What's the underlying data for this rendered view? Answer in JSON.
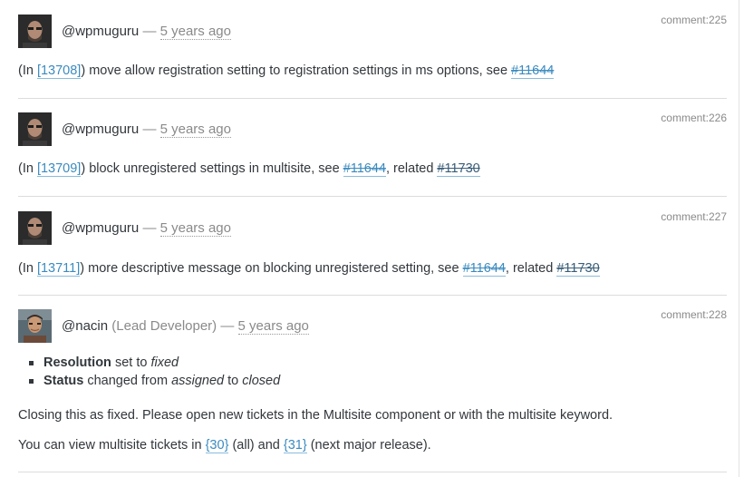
{
  "comments": [
    {
      "author": "@wpmuguru",
      "dash": "—",
      "ago": "5 years ago",
      "id": "comment:225",
      "text": {
        "pre": "(In ",
        "changeset": "[13708]",
        "mid": ") move allow registration setting to registration settings in ms options, see ",
        "ticket1": "#11644"
      }
    },
    {
      "author": "@wpmuguru",
      "dash": "—",
      "ago": "5 years ago",
      "id": "comment:226",
      "text": {
        "pre": "(In ",
        "changeset": "[13709]",
        "mid": ") block unregistered settings in multisite, see ",
        "ticket1": "#11644",
        "sep": ", related ",
        "ticket2": "#11730"
      }
    },
    {
      "author": "@wpmuguru",
      "dash": "—",
      "ago": "5 years ago",
      "id": "comment:227",
      "text": {
        "pre": "(In ",
        "changeset": "[13711]",
        "mid": ") more descriptive message on blocking unregistered setting, see ",
        "ticket1": "#11644",
        "sep": ", related ",
        "ticket2": "#11730"
      }
    },
    {
      "author": "@nacin",
      "role": "(Lead Developer)",
      "dash": "—",
      "ago": "5 years ago",
      "id": "comment:228",
      "changes": [
        {
          "field": "Resolution",
          "verb": " set to ",
          "to": "fixed"
        },
        {
          "field": "Status",
          "verb": " changed from ",
          "from": "assigned",
          "conj": " to ",
          "to": "closed"
        }
      ],
      "para1": "Closing this as fixed. Please open new tickets in the Multisite component or with the multisite keyword.",
      "para2": {
        "pre": "You can view multisite tickets in ",
        "link1": "{30}",
        "mid1": " (all) and ",
        "link2": "{31}",
        "post": " (next major release)."
      }
    }
  ],
  "colors": {
    "link": "#3b8bbf",
    "muted": "#8a8a8a",
    "text": "#32373c",
    "divider": "#dcdcdc"
  }
}
